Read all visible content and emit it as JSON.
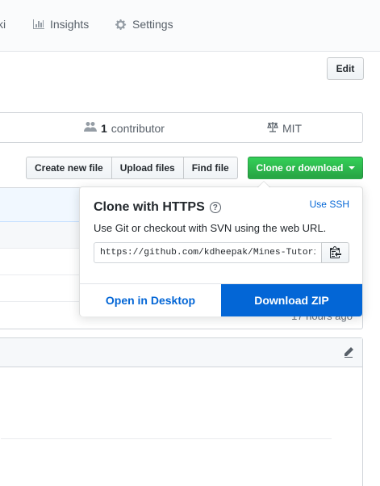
{
  "nav": {
    "wiki_label": "ki",
    "insights_label": "Insights",
    "settings_label": "Settings"
  },
  "header": {
    "edit_label": "Edit"
  },
  "summary": {
    "contributors_count": "1",
    "contributors_label": "contributor",
    "license_label": "MIT"
  },
  "file_nav": {
    "create_label": "Create new file",
    "upload_label": "Upload files",
    "find_label": "Find file",
    "clone_label": "Clone or download"
  },
  "file_list": {
    "age_text": "17 hours ago"
  },
  "clone_panel": {
    "title": "Clone with HTTPS",
    "use_ssh_label": "Use SSH",
    "description": "Use Git or checkout with SVN using the web URL.",
    "clone_url": "https://github.com/kdheepak/Mines-Tutorials.git",
    "open_desktop_label": "Open in Desktop",
    "download_zip_label": "Download ZIP"
  },
  "colors": {
    "clone_green": "#28a745",
    "download_blue": "#0366d6",
    "link_blue": "#0366d6"
  }
}
